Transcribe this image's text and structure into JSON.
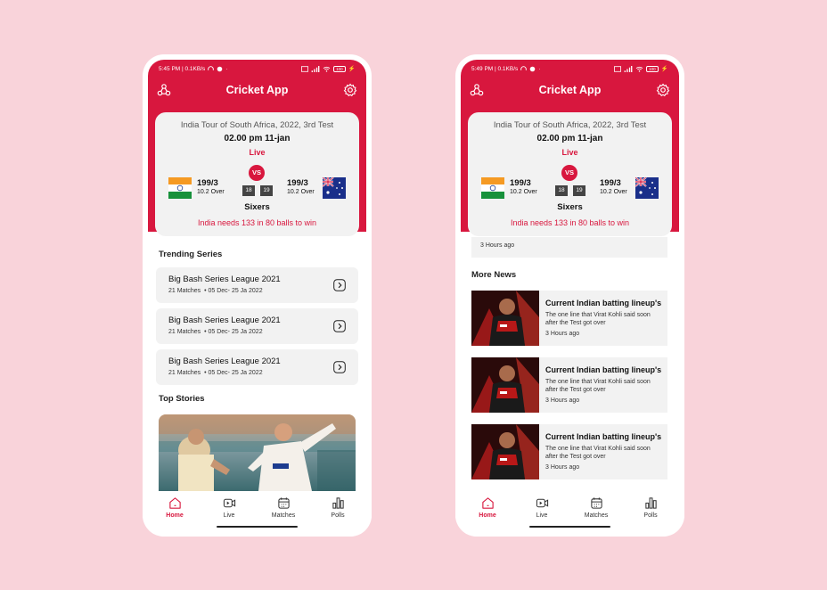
{
  "status": {
    "time": "5:45 PM | 0.1KB/s",
    "time2": "5:49 PM | 0.1KB/s",
    "battery": "100"
  },
  "app": {
    "title": "Cricket App"
  },
  "match": {
    "series": "India Tour of South Africa, 2022, 3rd Test",
    "time": "02.00 pm 11-jan",
    "status": "Live",
    "vs": "VS",
    "team1": {
      "score": "199/3",
      "overs": "10.2 Over"
    },
    "team2": {
      "score": "199/3",
      "overs": "10.2 Over"
    },
    "chip1": "18",
    "chip2": "19",
    "result": "Sixers",
    "needs": "India needs 133 in 80 balls to win"
  },
  "trending": {
    "title": "Trending Series",
    "items": [
      {
        "name": "Big Bash Series League 2021",
        "matches": "21 Matches",
        "dates": "05 Dec- 25 Ja 2022"
      },
      {
        "name": "Big Bash Series League 2021",
        "matches": "21 Matches",
        "dates": "05 Dec- 25 Ja 2022"
      },
      {
        "name": "Big Bash Series League 2021",
        "matches": "21 Matches",
        "dates": "05 Dec- 25 Ja 2022"
      }
    ]
  },
  "top_stories": {
    "title": "Top Stories"
  },
  "more_news": {
    "title": "More News",
    "prev_ago": "3 Hours ago",
    "items": [
      {
        "title": "Current Indian batting lineup's",
        "desc": "The one line that Virat Kohli said soon after the Test got over",
        "ago": "3 Hours ago"
      },
      {
        "title": "Current Indian batting lineup's",
        "desc": "The one line that Virat Kohli said soon after the Test got over",
        "ago": "3 Hours ago"
      },
      {
        "title": "Current Indian batting lineup's",
        "desc": "The one line that Virat Kohli said soon after the Test got over",
        "ago": "3 Hours ago"
      }
    ]
  },
  "tabs": [
    {
      "label": "Home",
      "icon": "home-icon"
    },
    {
      "label": "Live",
      "icon": "live-video-icon"
    },
    {
      "label": "Matches",
      "icon": "calendar-icon"
    },
    {
      "label": "Polls",
      "icon": "bar-chart-icon"
    }
  ],
  "colors": {
    "accent": "#d8173e",
    "card": "#f2f2f2",
    "background": "#f9d3da"
  }
}
